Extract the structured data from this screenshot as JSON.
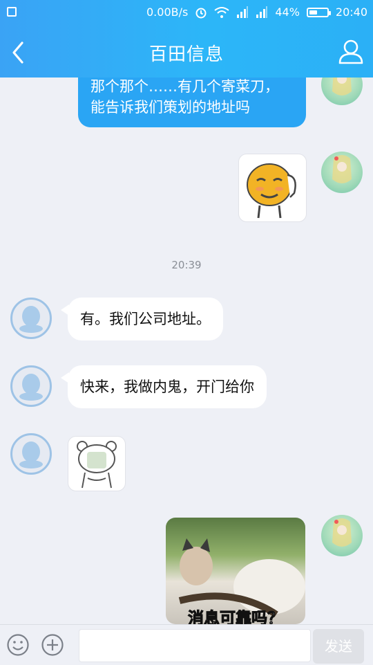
{
  "status_bar": {
    "net_speed": "0.00B/s",
    "battery_percent": "44%",
    "battery_level": 0.44,
    "time": "20:40",
    "icons": [
      "notification-icon",
      "alarm-icon",
      "wifi-icon",
      "signal-icon",
      "signal-icon",
      "battery-icon"
    ]
  },
  "header": {
    "title": "百田信息",
    "back_icon": "chevron-left-icon",
    "profile_icon": "user-icon"
  },
  "messages": {
    "m1_line1": "那个那个……有几个寄菜刀，",
    "m1_line2": "能告诉我们策划的地址吗",
    "timestamp": "20:39",
    "m2": "有。我们公司地址。",
    "m3": "快来，我做内鬼，开门给你",
    "photo_caption": "消息可靠吗？"
  },
  "input_bar": {
    "emoji_icon": "smiley-icon",
    "plus_icon": "plus-circle-icon",
    "placeholder": "",
    "send_label": "发送"
  },
  "colors": {
    "header_blue": "#2cb6f8",
    "bubble_blue": "#2aa5f4",
    "background": "#eef0f6"
  }
}
